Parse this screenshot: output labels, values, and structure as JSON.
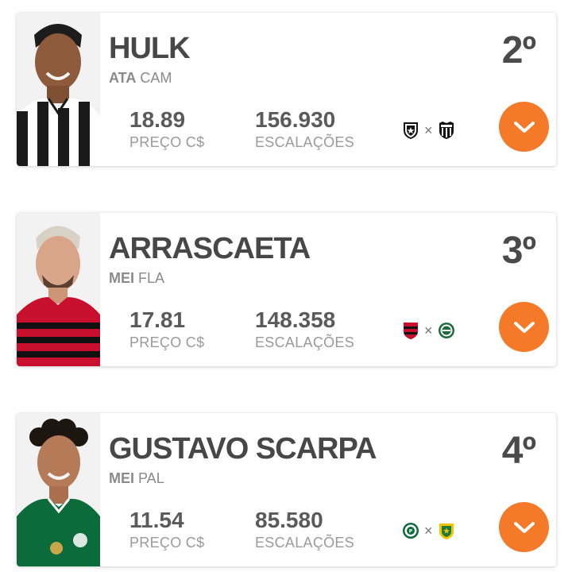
{
  "players": [
    {
      "name": "HULK",
      "position": "ATA",
      "club": "CAM",
      "rank": "2º",
      "price": "18.89",
      "price_label": "PREÇO C$",
      "lineups": "156.930",
      "lineups_label": "ESCALAÇÕES",
      "match_separator": "×",
      "home_crest_icon": "botafogo-crest-icon",
      "away_crest_icon": "atletico-mineiro-crest-icon",
      "expand_icon": "chevron-down-icon",
      "jersey_colors": [
        "#1a1a1a",
        "#ffffff"
      ]
    },
    {
      "name": "ARRASCAETA",
      "position": "MEI",
      "club": "FLA",
      "rank": "3º",
      "price": "17.81",
      "price_label": "PREÇO C$",
      "lineups": "148.358",
      "lineups_label": "ESCALAÇÕES",
      "match_separator": "×",
      "home_crest_icon": "flamengo-crest-icon",
      "away_crest_icon": "coritiba-crest-icon",
      "expand_icon": "chevron-down-icon",
      "jersey_colors": [
        "#c8102e",
        "#111111"
      ]
    },
    {
      "name": "GUSTAVO SCARPA",
      "position": "MEI",
      "club": "PAL",
      "rank": "4º",
      "price": "11.54",
      "price_label": "PREÇO C$",
      "lineups": "85.580",
      "lineups_label": "ESCALAÇÕES",
      "match_separator": "×",
      "home_crest_icon": "palmeiras-crest-icon",
      "away_crest_icon": "cuiaba-crest-icon",
      "expand_icon": "chevron-down-icon",
      "jersey_colors": [
        "#0b6b3a",
        "#ffffff"
      ]
    }
  ],
  "accent_color": "#f47a2a"
}
